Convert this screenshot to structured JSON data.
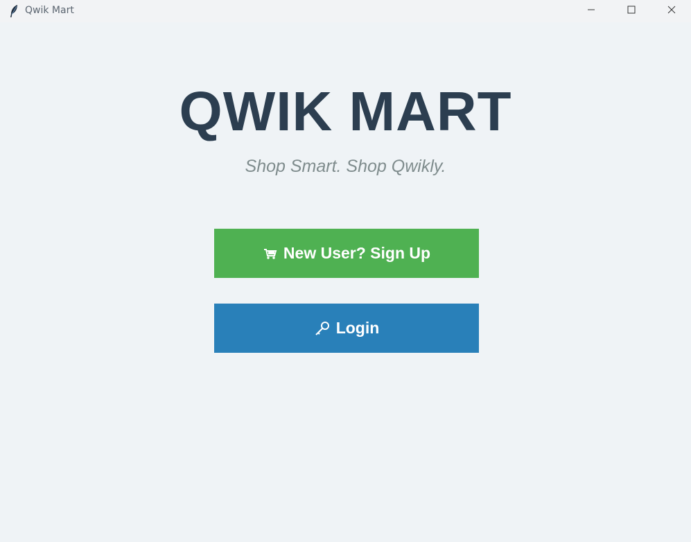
{
  "window": {
    "title": "Qwik Mart",
    "icon": "feather-icon",
    "controls": [
      "minimize-icon",
      "maximize-icon",
      "close-icon"
    ]
  },
  "main": {
    "title": "QWIK MART",
    "tagline": "Shop Smart. Shop Qwikly.",
    "signup_button": {
      "label": "New User? Sign Up",
      "icon": "shopping-cart-icon",
      "color": "#4fb152"
    },
    "login_button": {
      "label": "Login",
      "icon": "key-icon",
      "color": "#2980b9"
    }
  },
  "colors": {
    "background": "#eff3f6",
    "title": "#2c3e50",
    "tagline": "#7f8c8d"
  }
}
